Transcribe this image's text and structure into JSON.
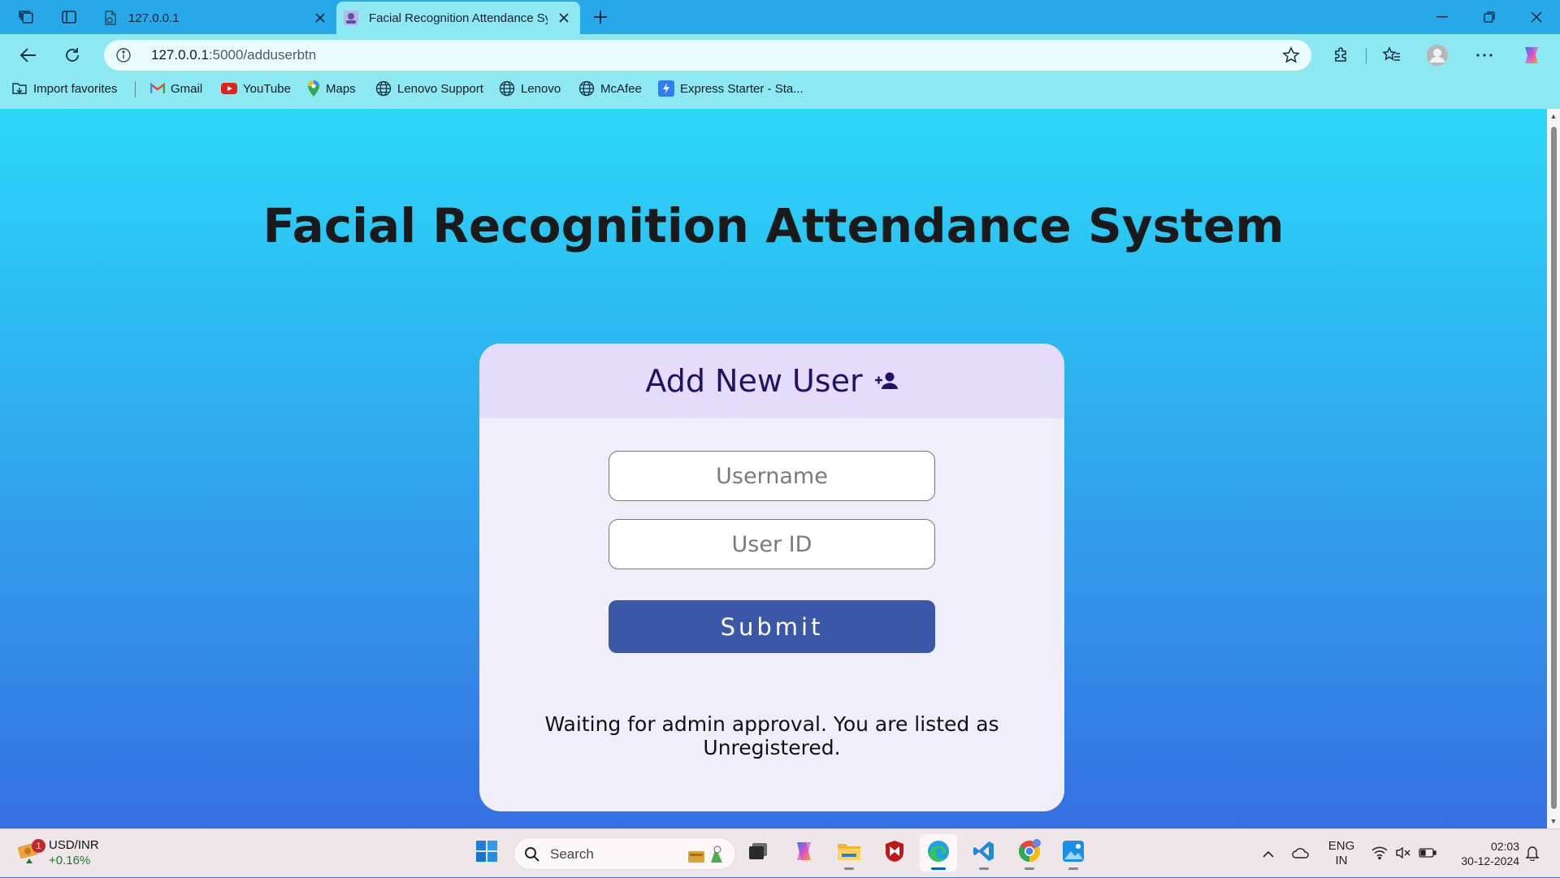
{
  "browser": {
    "tabs": [
      {
        "title": "127.0.0.1",
        "active": false
      },
      {
        "title": "Facial Recognition Attendance Sys",
        "active": true
      }
    ],
    "address": {
      "host": "127.0.0.1",
      "path": ":5000/adduserbtn"
    },
    "bookmarks": [
      {
        "label": "Import favorites",
        "icon": "import-favorites-icon"
      },
      {
        "label": "Gmail",
        "icon": "gmail-icon"
      },
      {
        "label": "YouTube",
        "icon": "youtube-icon"
      },
      {
        "label": "Maps",
        "icon": "maps-icon"
      },
      {
        "label": "Lenovo Support",
        "icon": "globe-icon"
      },
      {
        "label": "Lenovo",
        "icon": "globe-icon"
      },
      {
        "label": "McAfee",
        "icon": "globe-icon"
      },
      {
        "label": "Express Starter - Sta...",
        "icon": "express-icon"
      }
    ]
  },
  "page": {
    "title": "Facial Recognition Attendance System",
    "card": {
      "heading": "Add New User",
      "username_placeholder": "Username",
      "userid_placeholder": "User ID",
      "submit_label": "Submit",
      "status_message": "Waiting for admin approval. You are listed as Unregistered."
    }
  },
  "taskbar": {
    "widget": {
      "label": "USD/INR",
      "change": "+0.16%",
      "badge": "1"
    },
    "search_label": "Search",
    "language": {
      "line1": "ENG",
      "line2": "IN"
    },
    "clock": {
      "time": "02:03",
      "date": "30-12-2024"
    }
  },
  "colors": {
    "page_gradient_top": "#2ad8f8",
    "page_gradient_bottom": "#3570e2",
    "card_bg": "#f1eefb",
    "card_header_bg": "#e4dcfa",
    "heading_color": "#1e1464",
    "submit_bg": "#3b58a8"
  }
}
